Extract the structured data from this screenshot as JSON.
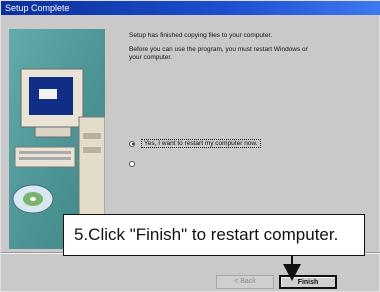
{
  "window": {
    "title": "Setup Complete"
  },
  "message": {
    "line1": "Setup has finished copying files to your computer.",
    "line2a": "Before you can use the program, you must restart Windows or",
    "line2b": "your computer."
  },
  "options": {
    "restart_now": {
      "label": "Yes, I want to restart my computer now.",
      "selected": true
    },
    "restart_later": {
      "selected": false
    }
  },
  "buttons": {
    "back": "< Back",
    "finish": "Finish"
  },
  "callout": {
    "text": "5.Click \"Finish\" to restart computer."
  },
  "icons": [
    "computer-icon",
    "cd-icon",
    "arrow-down-icon"
  ]
}
